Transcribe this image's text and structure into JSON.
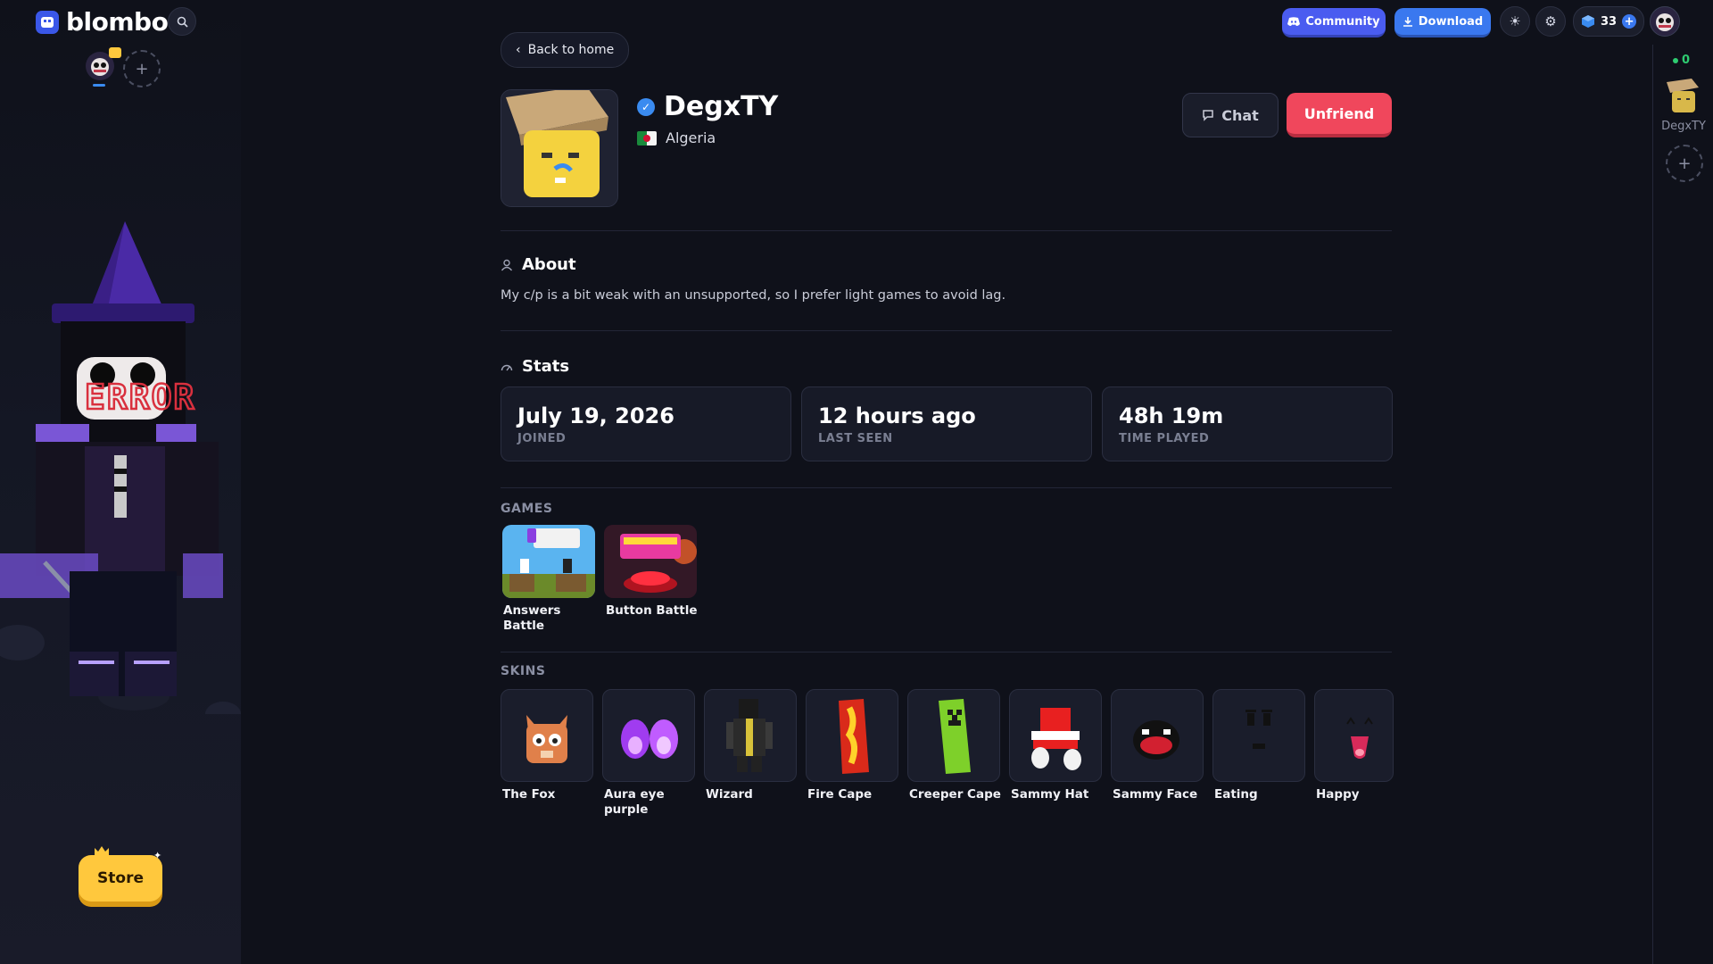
{
  "app": {
    "name": "blombo"
  },
  "topbar": {
    "community_label": "Community",
    "download_label": "Download",
    "gems_count": "33"
  },
  "left_sidebar": {
    "store_label": "Store",
    "avatar_badge": "ERROR"
  },
  "profile": {
    "back_label": "Back to home",
    "username": "DegxTY",
    "country": "Algeria",
    "chat_label": "Chat",
    "unfriend_label": "Unfriend",
    "about_title": "About",
    "about_text": "My c/p is a bit weak with an unsupported, so I prefer light games to avoid lag.",
    "stats_title": "Stats",
    "stats": [
      {
        "value": "July 19, 2026",
        "label": "JOINED"
      },
      {
        "value": "12 hours ago",
        "label": "LAST SEEN"
      },
      {
        "value": "48h 19m",
        "label": "TIME PLAYED"
      }
    ],
    "games_title": "GAMES",
    "games": [
      {
        "name": "Answers Battle"
      },
      {
        "name": "Button Battle"
      }
    ],
    "skins_title": "SKINS",
    "skins": [
      {
        "name": "The Fox"
      },
      {
        "name": "Aura eye purple"
      },
      {
        "name": "Wizard"
      },
      {
        "name": "Fire Cape"
      },
      {
        "name": "Creeper Cape"
      },
      {
        "name": "Sammy Hat"
      },
      {
        "name": "Sammy Face"
      },
      {
        "name": "Eating"
      },
      {
        "name": "Happy"
      }
    ]
  },
  "right_sidebar": {
    "online_count": "0",
    "friend_name": "DegxTY"
  },
  "colors": {
    "accent": "#4a5cf0",
    "danger": "#f0475c",
    "store": "#ffc83d",
    "online": "#2ecc71"
  }
}
